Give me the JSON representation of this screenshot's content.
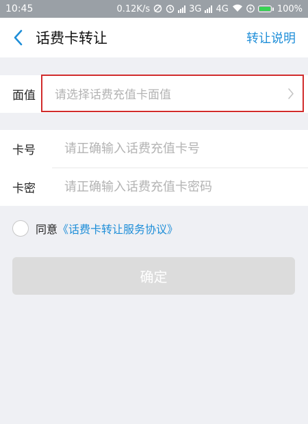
{
  "status_bar": {
    "time": "10:45",
    "speed": "0.12K/s",
    "network_3g": "3G",
    "network_4g": "4G",
    "battery": "100%",
    "icons": [
      "no-notify-icon",
      "alarm-icon",
      "signal-icon",
      "signal-icon",
      "wifi-icon",
      "charging-icon",
      "battery-icon"
    ]
  },
  "header": {
    "title": "话费卡转让",
    "right_link": "转让说明",
    "back_icon": "chevron-left-icon",
    "accent_color": "#1e8ed8"
  },
  "face_value": {
    "label": "面值",
    "placeholder": "请选择话费充值卡面值",
    "highlight_color": "#d12b2b"
  },
  "card_number": {
    "label": "卡号",
    "placeholder": "请正确输入话费充值卡号",
    "value": ""
  },
  "card_password": {
    "label": "卡密",
    "placeholder": "请正确输入话费充值卡密码",
    "value": ""
  },
  "agreement": {
    "prefix": "同意",
    "link": "《话费卡转让服务协议》",
    "checked": false
  },
  "confirm_button": {
    "label": "确定",
    "enabled": false
  }
}
